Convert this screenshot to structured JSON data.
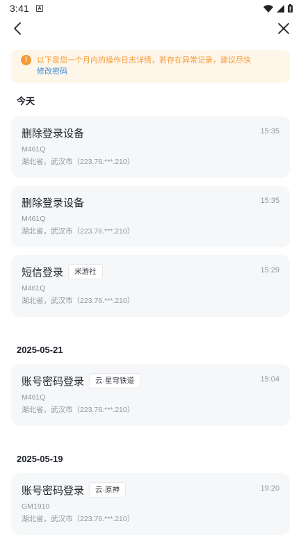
{
  "status_bar": {
    "time": "3:41",
    "app_icon": "A",
    "icons": [
      "wifi-icon",
      "signal-icon",
      "battery-icon"
    ]
  },
  "app_bar": {
    "back_icon": "back-arrow-icon",
    "close_icon": "close-icon"
  },
  "notice": {
    "icon": "warning-icon",
    "icon_glyph": "!",
    "text": "以下是您一个月内的操作日志详情，若存在异常记录，建议尽快",
    "link": "修改密码",
    "color": "#f59b33",
    "background": "#fff6ea",
    "link_color": "#3a8ad9"
  },
  "sections": [
    {
      "title": "今天",
      "records": [
        {
          "action": "删除登录设备",
          "tag": "",
          "time": "15:35",
          "device": "M461Q",
          "location": "湖北省，武汉市（223.76.***.210）"
        },
        {
          "action": "删除登录设备",
          "tag": "",
          "time": "15:35",
          "device": "M461Q",
          "location": "湖北省，武汉市（223.76.***.210）"
        },
        {
          "action": "短信登录",
          "tag": "米游社",
          "time": "15:29",
          "device": "M461Q",
          "location": "湖北省，武汉市（223.76.***.210）"
        }
      ]
    },
    {
      "title": "2025-05-21",
      "records": [
        {
          "action": "账号密码登录",
          "tag": "云·星穹铁道",
          "time": "15:04",
          "device": "M461Q",
          "location": "湖北省，武汉市（223.76.***.210）"
        }
      ]
    },
    {
      "title": "2025-05-19",
      "records": [
        {
          "action": "账号密码登录",
          "tag": "云·原神",
          "time": "19:20",
          "device": "GM1910",
          "location": "湖北省，武汉市（223.76.***.210）"
        }
      ]
    }
  ]
}
